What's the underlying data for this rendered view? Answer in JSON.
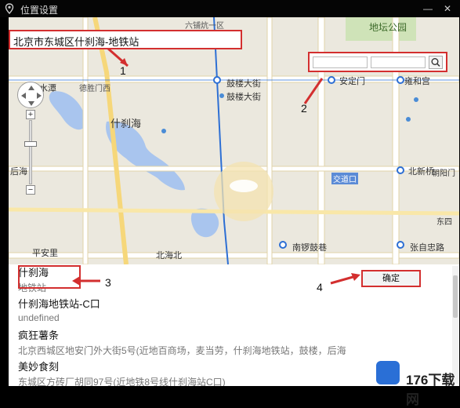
{
  "window": {
    "title": "位置设置"
  },
  "address": {
    "value": "北京市东城区什刹海-地铁站"
  },
  "search": {
    "placeholder_1": "",
    "placeholder_2": ""
  },
  "map_labels": {
    "district_top": "六铺炕一区",
    "park": "地坛公园",
    "road_deshengmen": "德胜门西",
    "road_guloudajie": "鼓楼大街",
    "road_andingmen": "安定门",
    "road_yonghegong": "雍和宫",
    "road_guloudajie2": "鼓楼大街",
    "shichahai": "什刹海",
    "beixinqiao": "北新桥",
    "jiaodaokou": "交道口",
    "beihai": "北海北",
    "pinganli": "平安里",
    "nanluoguxiang": "南锣鼓巷",
    "zhangzizhonglu": "张自忠路",
    "jishuitan": "积水潭",
    "houhai": "后海",
    "dongsi": "东四",
    "chaoyangmen": "朝阳门"
  },
  "results": [
    {
      "name": "什刹海",
      "address": "地铁站"
    },
    {
      "name": "什刹海地铁站-C口",
      "address": "undefined"
    },
    {
      "name": "疯狂薯条",
      "address": "北京西城区地安门外大街5号(近地百商场，麦当劳，什刹海地铁站，鼓楼，后海"
    },
    {
      "name": "美妙食刻",
      "address": "东城区方砖厂胡同97号(近地铁8号线什刹海站C口)"
    }
  ],
  "buttons": {
    "confirm": "确定",
    "minimize": "—",
    "close": "✕",
    "zoom_in": "+",
    "zoom_out": "−"
  },
  "annotations": [
    "1",
    "2",
    "3",
    "4"
  ],
  "watermark": "176下载网",
  "colors": {
    "highlight": "#d32f2f",
    "map_bg": "#ece9df",
    "water": "#8fb4e8",
    "metro": "#2d6fd4"
  }
}
